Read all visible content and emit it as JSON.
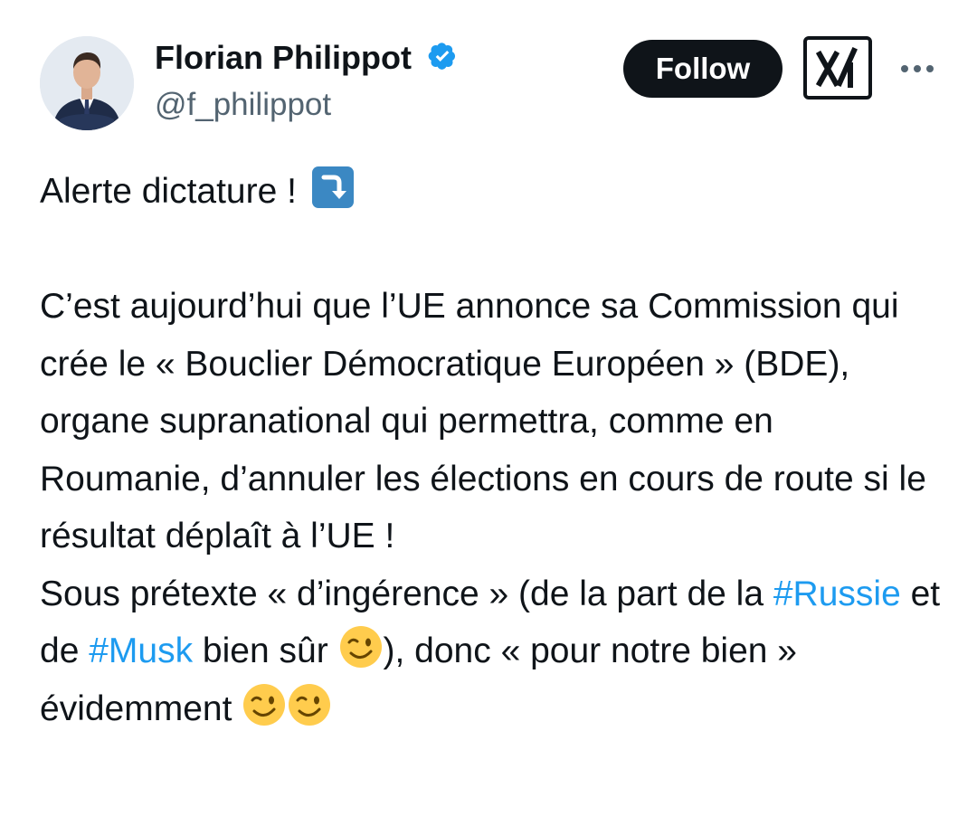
{
  "author": {
    "display_name": "Florian Philippot",
    "handle": "@f_philippot",
    "verified": true
  },
  "actions": {
    "follow_label": "Follow",
    "grok_icon": "grok-icon",
    "more_icon": "more-options-icon"
  },
  "tweet": {
    "line1": "Alerte dictature !",
    "para2": "C’est aujourd’hui que l’UE annonce sa Commission qui crée le « Bouclier Démocratique Européen » (BDE), organe supranational qui permettra, comme en Roumanie, d’annuler les élections en cours de route si le résultat déplaît à l’UE !",
    "para3_a": "Sous prétexte « d’ingérence » (de la part de la ",
    "hashtag_russie": "#Russie",
    "para3_b": " et de ",
    "hashtag_musk": "#Musk",
    "para3_c": " bien sûr ",
    "para3_d": "), donc « pour notre bien » évidemment "
  },
  "colors": {
    "text": "#0f1419",
    "secondary": "#536471",
    "link": "#1d9bf0",
    "verified": "#1d9bf0"
  }
}
